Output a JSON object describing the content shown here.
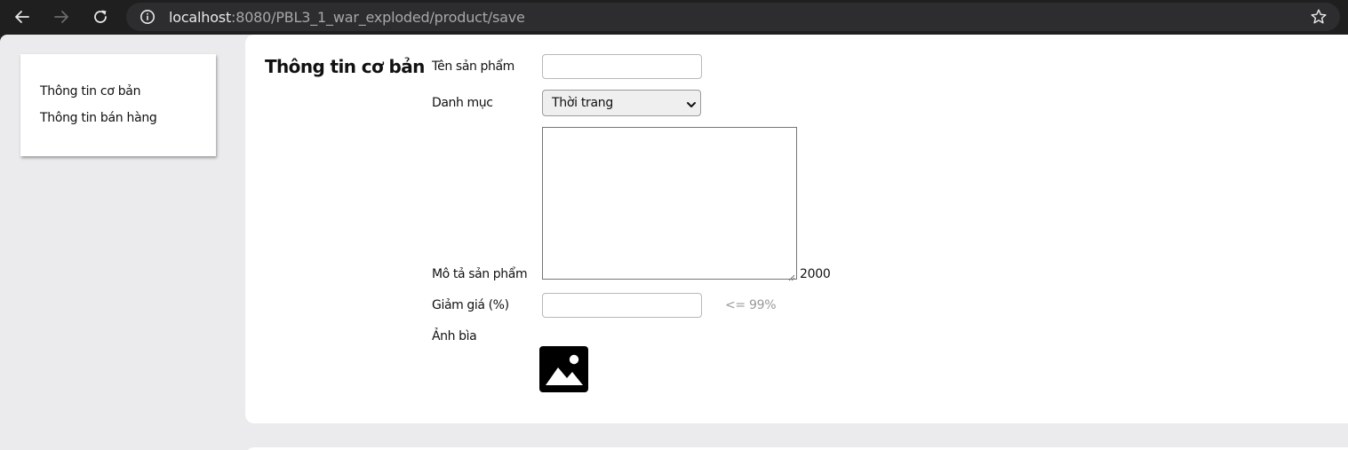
{
  "browser": {
    "url_host": "localhost",
    "url_rest": ":8080/PBL3_1_war_exploded/product/save",
    "icons": [
      "back-icon",
      "forward-icon",
      "reload-icon",
      "site-info-icon",
      "bookmark-star-icon"
    ]
  },
  "sidebar": {
    "items": [
      {
        "label": "Thông tin cơ bản"
      },
      {
        "label": "Thông tin bán hàng"
      }
    ]
  },
  "form": {
    "title": "Thông tin cơ bản",
    "product_name": {
      "label": "Tên sản phẩm",
      "value": ""
    },
    "category": {
      "label": "Danh mục",
      "selected": "Thời trang"
    },
    "description": {
      "label": "Mô tả sản phẩm",
      "value": "",
      "char_limit": "2000"
    },
    "discount": {
      "label": "Giảm giá (%)",
      "value": "",
      "hint": "<= 99%"
    },
    "cover": {
      "label": "Ảnh bìa",
      "icon": "image-placeholder-icon"
    }
  },
  "colors": {
    "chrome_bg": "#1f1f1f",
    "omnibox_bg": "#2d2d2f",
    "page_bg": "#ebebed",
    "card_bg": "#ffffff",
    "hint_text": "#9a9a9a"
  }
}
